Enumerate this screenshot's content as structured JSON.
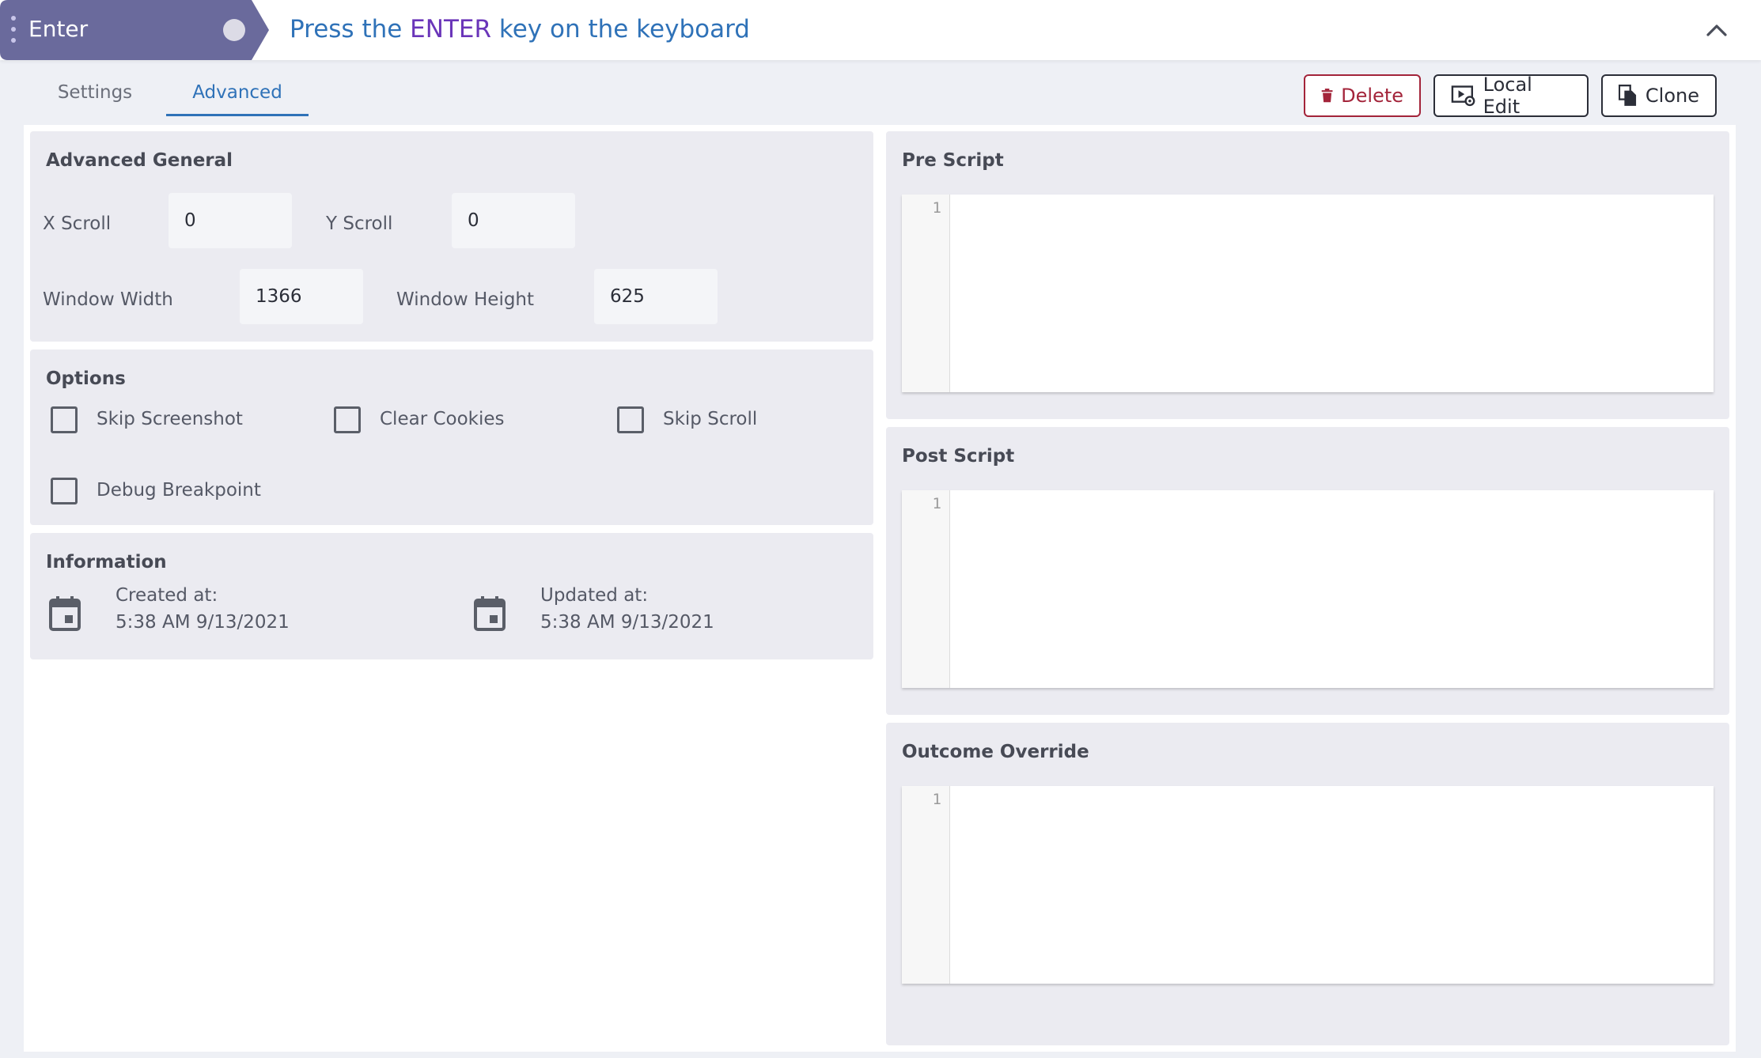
{
  "header": {
    "step_name": "Enter",
    "desc_prefix": "Press the ",
    "desc_key": "ENTER",
    "desc_suffix": "  key on the keyboard",
    "collapse_icon": "chevron-up-icon",
    "tag_color": "#6a6a9c",
    "key_color": "#6a35b9",
    "text_color": "#2f72b8"
  },
  "tabs": {
    "settings": "Settings",
    "advanced": "Advanced",
    "active": "Advanced"
  },
  "actions": {
    "delete": "Delete",
    "local_edit": "Local Edit",
    "clone": "Clone"
  },
  "advanced_general": {
    "title": "Advanced General",
    "x_scroll_label": "X Scroll",
    "x_scroll_value": "0",
    "y_scroll_label": "Y Scroll",
    "y_scroll_value": "0",
    "window_width_label": "Window Width",
    "window_width_value": "1366",
    "window_height_label": "Window Height",
    "window_height_value": "625"
  },
  "options": {
    "title": "Options",
    "skip_screenshot": "Skip Screenshot",
    "clear_cookies": "Clear Cookies",
    "skip_scroll": "Skip Scroll",
    "debug_breakpoint": "Debug Breakpoint"
  },
  "information": {
    "title": "Information",
    "created_label": "Created at:",
    "created_value": "5:38 AM 9/13/2021",
    "updated_label": "Updated at:",
    "updated_value": "5:38 AM 9/13/2021"
  },
  "scripts": {
    "pre_title": "Pre Script",
    "post_title": "Post Script",
    "outcome_title": "Outcome Override",
    "line_number": "1"
  }
}
